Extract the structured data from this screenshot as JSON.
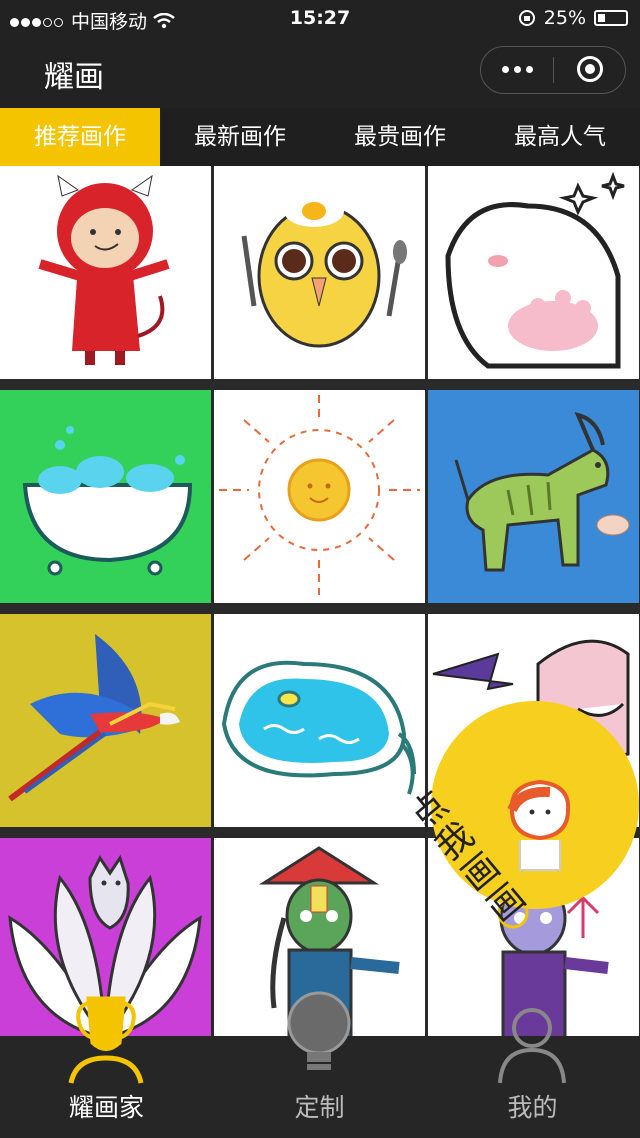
{
  "status_bar": {
    "carrier": "中国移动",
    "time": "15:27",
    "battery": "25%"
  },
  "header": {
    "title": "耀画"
  },
  "tabs": [
    {
      "label": "推荐画作",
      "active": true
    },
    {
      "label": "最新画作",
      "active": false
    },
    {
      "label": "最贵画作",
      "active": false
    },
    {
      "label": "最高人气",
      "active": false
    }
  ],
  "artworks": [
    {
      "subject": "red-devil-boy"
    },
    {
      "subject": "egg-owl"
    },
    {
      "subject": "white-bear"
    },
    {
      "subject": "bathtub"
    },
    {
      "subject": "sun"
    },
    {
      "subject": "green-goat"
    },
    {
      "subject": "macaw-parrot"
    },
    {
      "subject": "pool"
    },
    {
      "subject": "bat-monster"
    },
    {
      "subject": "white-fox-lotus"
    },
    {
      "subject": "jiangshi-green"
    },
    {
      "subject": "jiangshi-purple"
    }
  ],
  "floating_button": {
    "text": "点我画画"
  },
  "bottom_nav": [
    {
      "label": "耀画家",
      "icon": "trophy-icon",
      "active": true
    },
    {
      "label": "定制",
      "icon": "lightbulb-icon",
      "active": false
    },
    {
      "label": "我的",
      "icon": "profile-icon",
      "active": false
    }
  ],
  "colors": {
    "accent": "#f5c400",
    "bar": "#222222",
    "tab_bg": "#1f1f1f"
  }
}
